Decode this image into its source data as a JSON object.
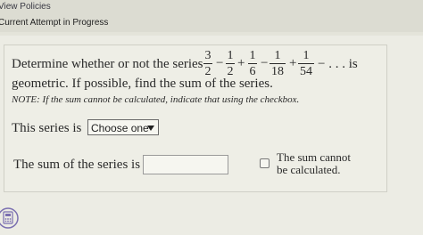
{
  "header": {
    "view_policies": "View Policies",
    "attempt_status": "Current Attempt in Progress"
  },
  "question": {
    "prefix": "Determine whether or not the series",
    "terms": [
      {
        "num": "3",
        "den": "2"
      },
      {
        "num": "1",
        "den": "2"
      },
      {
        "num": "1",
        "den": "6"
      },
      {
        "num": "1",
        "den": "18"
      },
      {
        "num": "1",
        "den": "54"
      }
    ],
    "operators": [
      "−",
      "+",
      "−",
      "+"
    ],
    "suffix": "− . . . is",
    "line2": "geometric. If possible, find the sum of the series.",
    "note": "NOTE: If the sum cannot be calculated, indicate that using the checkbox."
  },
  "series_type": {
    "label": "This series is",
    "selected": "Choose one"
  },
  "sum": {
    "label": "The sum of the series is",
    "value": ""
  },
  "cannot_calc": {
    "line1": "The sum cannot",
    "line2": "be calculated.",
    "checked": false
  },
  "icons": {
    "calculator": "calculator-icon",
    "dropdown": "chevron-down-icon"
  }
}
